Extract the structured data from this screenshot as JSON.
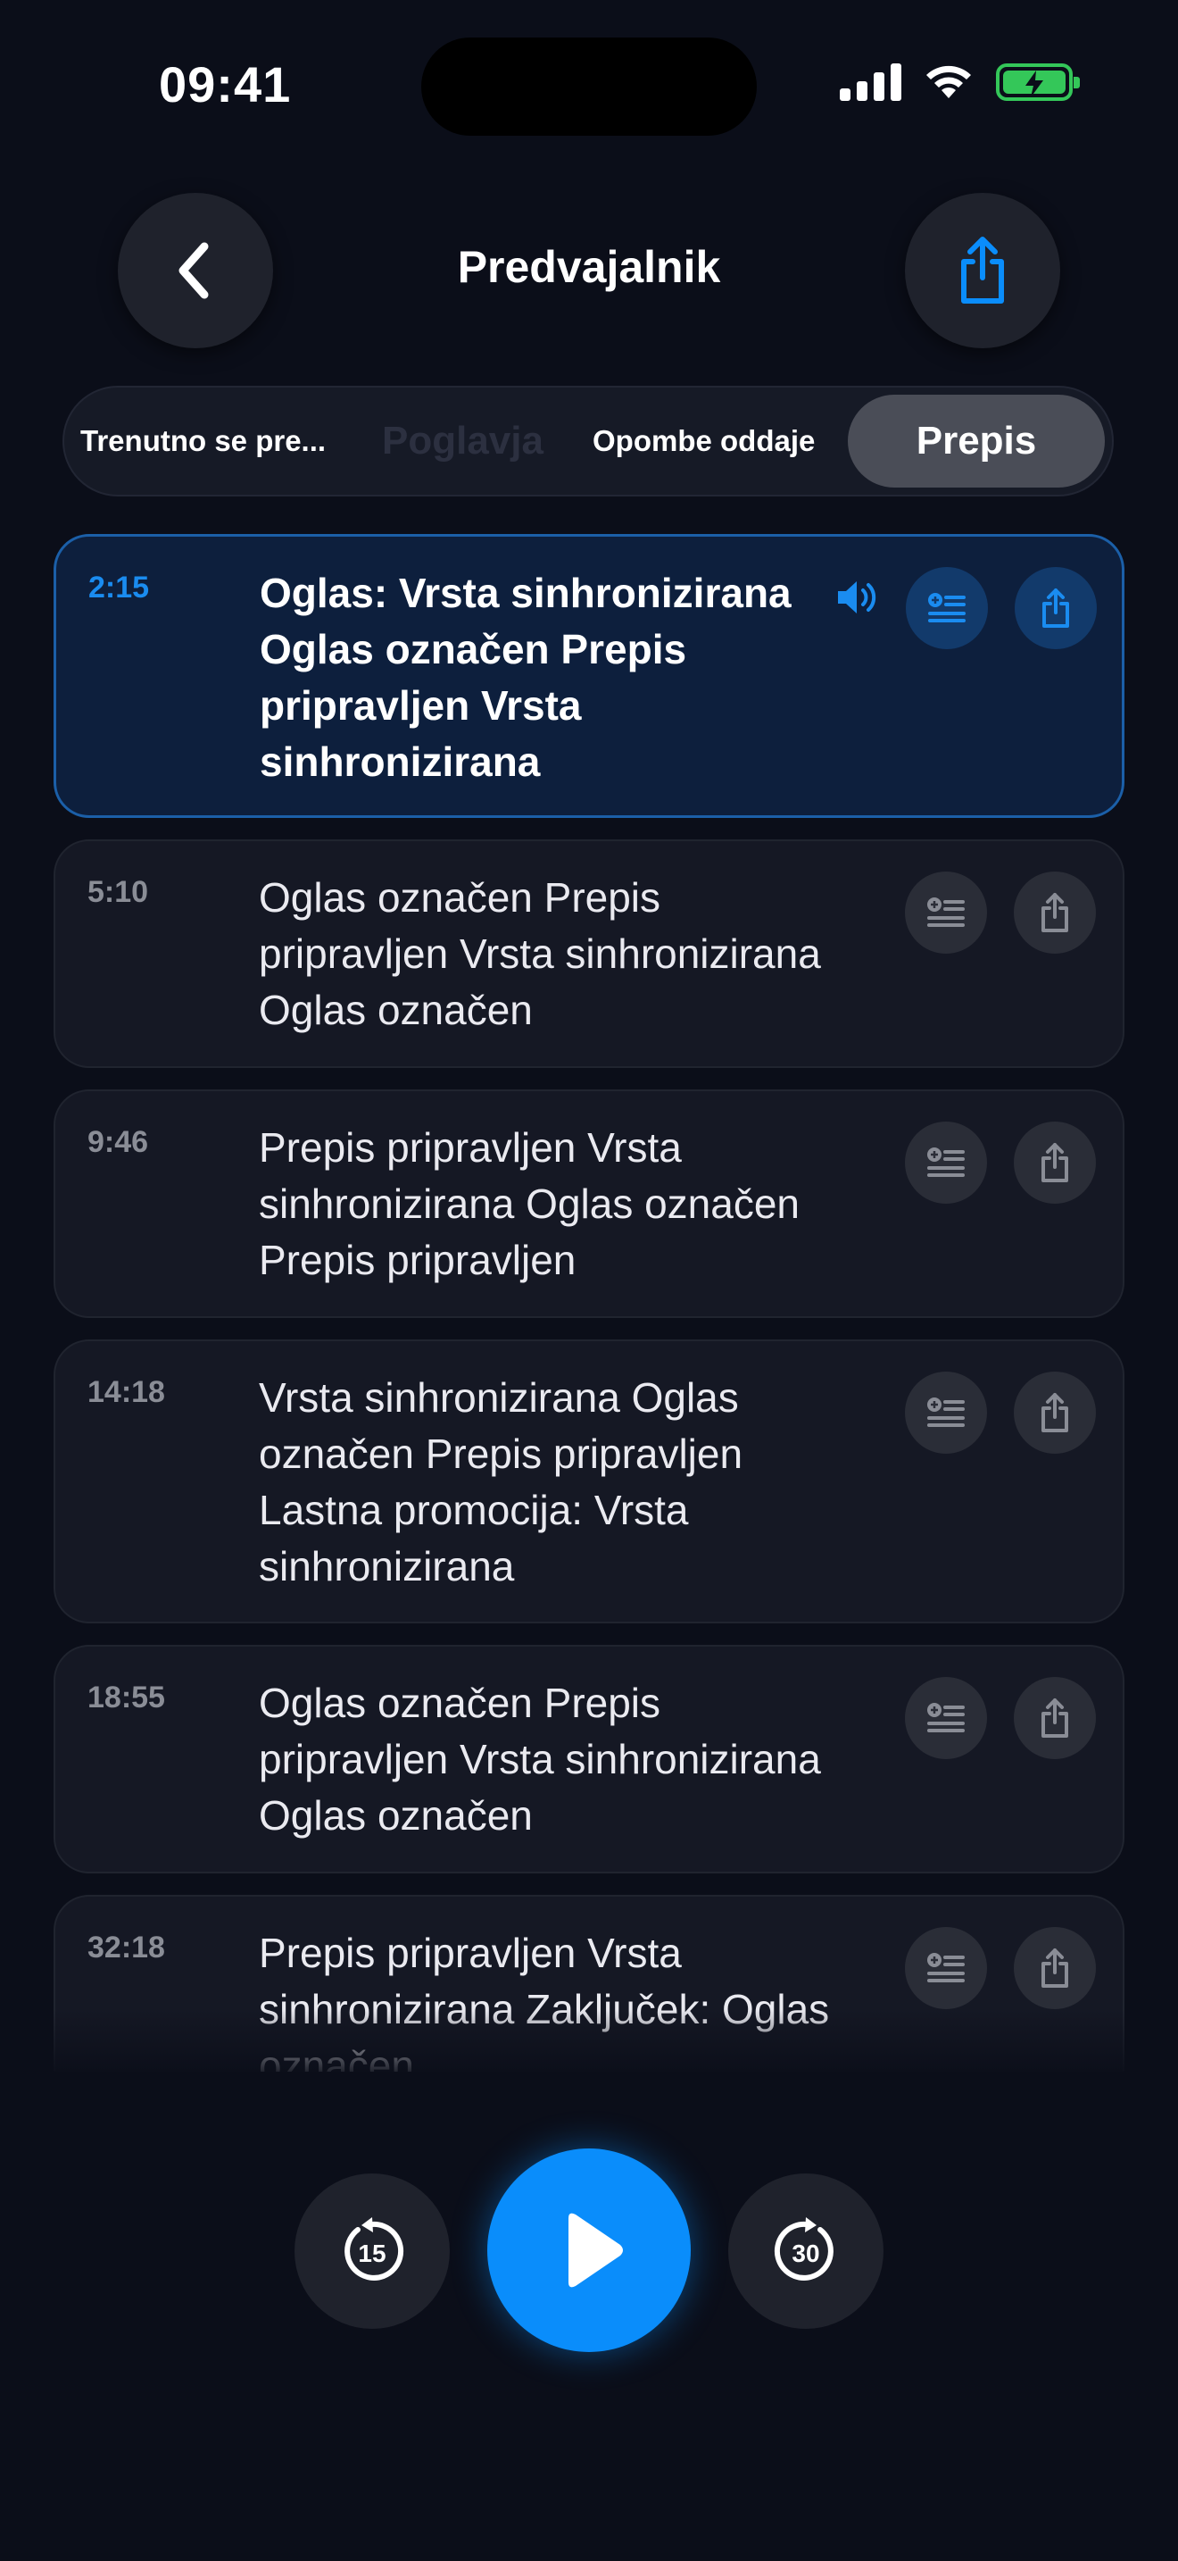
{
  "status_bar": {
    "time": "09:41"
  },
  "header": {
    "title": "Predvajalnik"
  },
  "tabs": {
    "current": "Trenutno se pre...",
    "chapters": "Poglavja",
    "notes": "Opombe oddaje",
    "transcript": "Prepis"
  },
  "transcript": {
    "rows": [
      {
        "time": "2:15",
        "text": "Oglas: Vrsta sinhronizirana Oglas označen Prepis pripravljen Vrsta sinhronizirana"
      },
      {
        "time": "5:10",
        "text": "Oglas označen Prepis pripravljen Vrsta sinhronizirana Oglas označen"
      },
      {
        "time": "9:46",
        "text": "Prepis pripravljen Vrsta sinhronizirana Oglas označen Prepis pripravljen"
      },
      {
        "time": "14:18",
        "text": "Vrsta sinhronizirana Oglas označen Prepis pripravljen Lastna promocija: Vrsta sinhronizirana"
      },
      {
        "time": "18:55",
        "text": "Oglas označen Prepis pripravljen Vrsta sinhronizirana Oglas označen"
      },
      {
        "time": "32:18",
        "text": "Prepis pripravljen Vrsta sinhronizirana Zaključek: Oglas označen"
      }
    ]
  },
  "controls": {
    "skip_back": "15",
    "skip_forward": "30"
  },
  "colors": {
    "accent": "#0a8dfb",
    "background": "#0b0e19",
    "battery": "#34c759"
  }
}
